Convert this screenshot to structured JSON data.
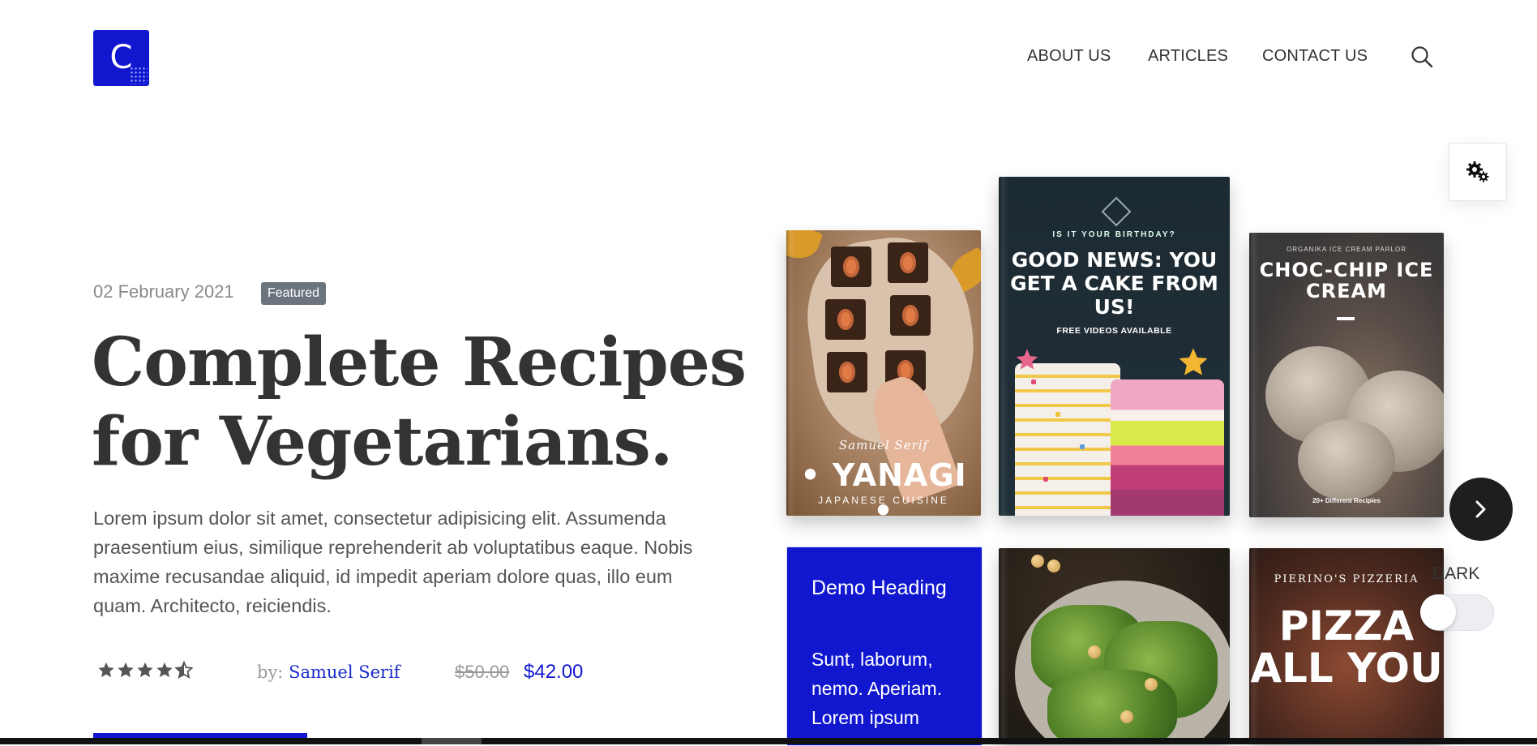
{
  "brand": {
    "logo_letter": "C",
    "color": "#1017cf"
  },
  "nav": {
    "items": [
      "ABOUT US",
      "ARTICLES",
      "CONTACT US"
    ],
    "search_icon": "search-icon"
  },
  "settings": {
    "icon": "gears-icon"
  },
  "hero": {
    "date": "02 February 2021",
    "badge": "Featured",
    "title_line1": "Complete Recipes",
    "title_line2": "for Vegetarians.",
    "lead": "Lorem ipsum dolor sit amet, consectetur adipisicing elit. Assumenda praesentium eius, similique reprehenderit ab voluptatibus eaque. Nobis maxime recusandae aliquid, id impedit aperiam dolore quas, illo eum quam. Architecto, reiciendis.",
    "rating": 4.5,
    "rating_max": 5,
    "author_prefix": "by:",
    "author_name": "Samuel Serif",
    "old_price": "$50.00",
    "price": "$42.00"
  },
  "books": {
    "yanagi": {
      "author": "Samuel Serif",
      "title": "YANAGI",
      "subtitle": "JAPANESE CUISINE"
    },
    "cake": {
      "kicker": "IS IT YOUR BIRTHDAY?",
      "title": "GOOD NEWS: YOU GET A CAKE FROM US!",
      "subtitle": "FREE VIDEOS AVAILABLE"
    },
    "icecream": {
      "kicker": "ORGANIKA ICE CREAM PARLOR",
      "title": "CHOC-CHIP ICE CREAM",
      "footer": "20+ Different Recipies"
    },
    "demo": {
      "heading": "Demo Heading",
      "text": "Sunt, laborum, nemo. Aperiam. Lorem ipsum"
    },
    "pizza": {
      "kicker": "PIERINO'S PIZZERIA",
      "title": "PIZZA ALL YOU"
    }
  },
  "carousel": {
    "next_icon": "chevron-right-icon"
  },
  "theme_toggle": {
    "label": "DARK",
    "on": false
  }
}
